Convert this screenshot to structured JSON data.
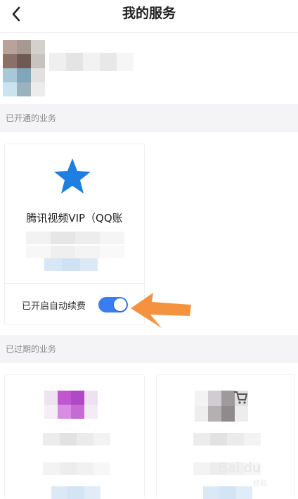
{
  "header": {
    "title": "我的服务"
  },
  "sections": {
    "active": "已开通的业务",
    "expired": "已过期的业务"
  },
  "active_service": {
    "name": "腾讯视频VIP（QQ账",
    "auto_renew_label": "已开启自动续费",
    "auto_renew_on": true
  },
  "icons": {
    "back": "chevron-left-icon",
    "service": "star-moon-icon",
    "toggle": "toggle-switch-icon",
    "annotation": "orange-arrow-icon"
  },
  "colors": {
    "toggle": "#3a7df0",
    "arrow": "#f4923f",
    "star": "#1f7fe0",
    "moon": "#f2c230",
    "section_bg": "#f4f4f6"
  },
  "watermark": {
    "text": "Bai du",
    "sub": "经验"
  }
}
